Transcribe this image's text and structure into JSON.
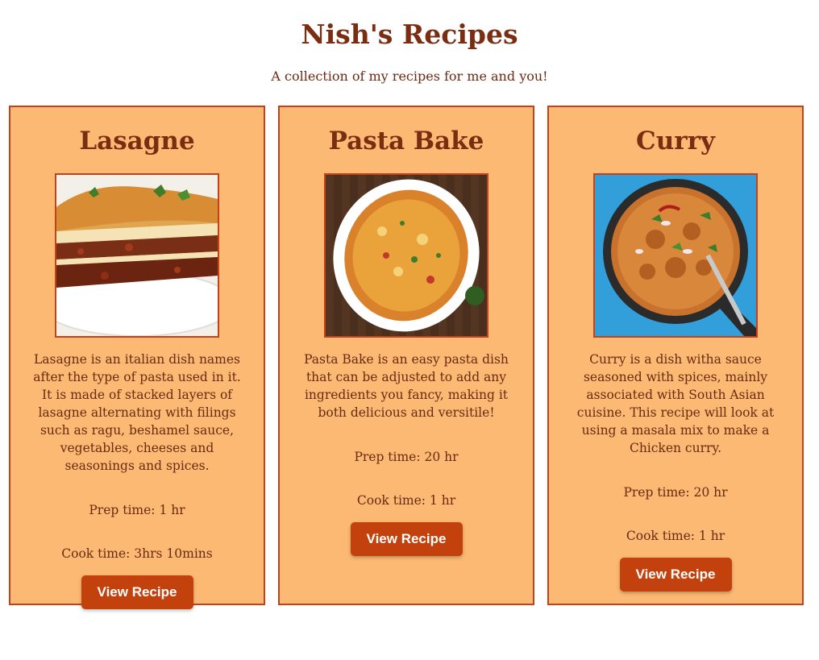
{
  "header": {
    "title": "Nish's Recipes",
    "subtitle": "A collection of my recipes for me and you!"
  },
  "colors": {
    "card_background": "#fbb973",
    "card_border": "#c2431a",
    "title_text": "#7a2d10",
    "button_background": "#c2410c",
    "button_text": "#ffffff"
  },
  "recipes": [
    {
      "title": "Lasagne",
      "image": "lasagne-photo",
      "description": "Lasagne is an italian dish names after the type of pasta used in it. It is made of stacked layers of lasagne alternating with filings such as ragu, beshamel sauce, vegetables, cheeses and seasonings and spices.",
      "prep_time": "Prep time: 1 hr",
      "cook_time": "Cook time: 3hrs 10mins",
      "button_label": "View Recipe"
    },
    {
      "title": "Pasta Bake",
      "image": "pasta-bake-photo",
      "description": "Pasta Bake is an easy pasta dish that can be adjusted to add any ingredients you fancy, making it both delicious and versitile!",
      "prep_time": "Prep time: 20 hr",
      "cook_time": "Cook time: 1 hr",
      "button_label": "View Recipe"
    },
    {
      "title": "Curry",
      "image": "curry-photo",
      "description": "Curry is a dish witha sauce seasoned with spices, mainly associated with South Asian cuisine. This recipe will look at using a masala mix to make a Chicken curry.",
      "prep_time": "Prep time: 20 hr",
      "cook_time": "Cook time: 1 hr",
      "button_label": "View Recipe"
    }
  ]
}
